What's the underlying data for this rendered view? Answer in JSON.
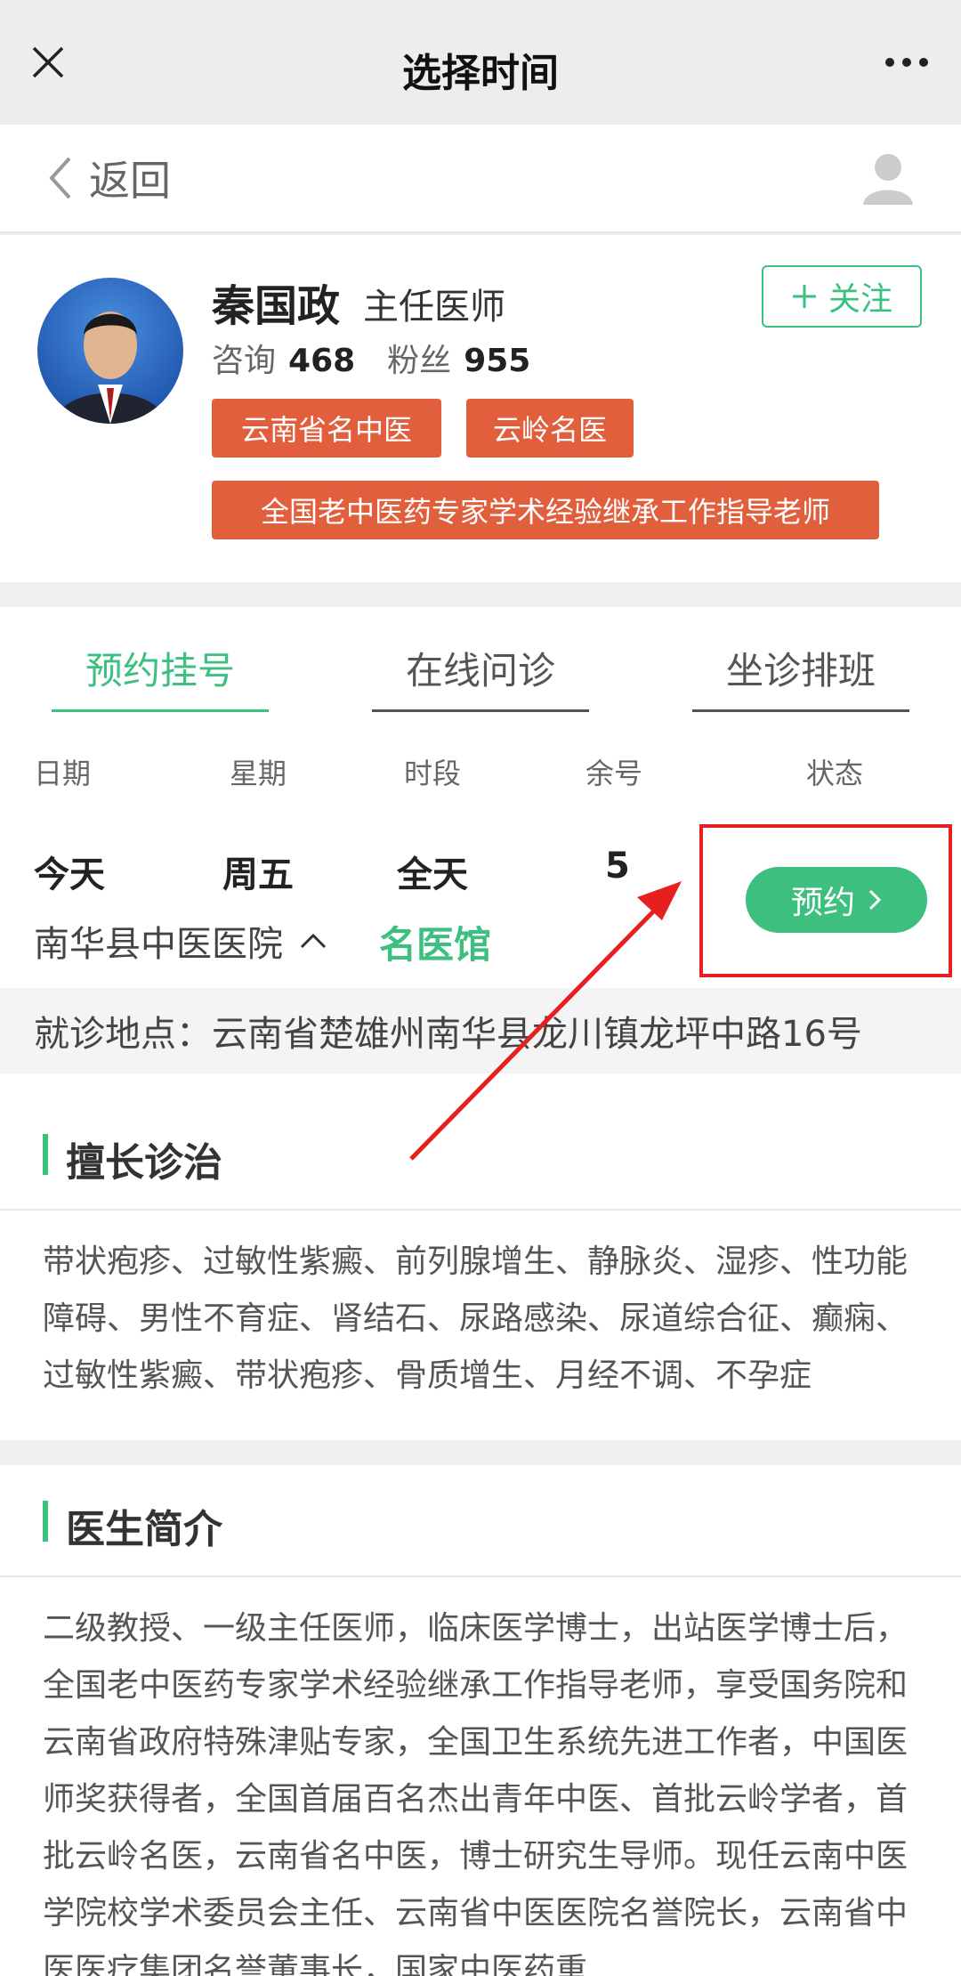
{
  "topbar": {
    "title": "选择时间"
  },
  "backbar": {
    "back_label": "返回"
  },
  "doctor": {
    "name": "秦国政",
    "title": "主任医师",
    "follow_label": "关注",
    "consult_label": "咨询",
    "consult_count": "468",
    "fans_label": "粉丝",
    "fans_count": "955",
    "tags": [
      "云南省名中医",
      "云岭名医",
      "全国老中医药专家学术经验继承工作指导老师"
    ]
  },
  "tabs": [
    {
      "label": "预约挂号",
      "active": true
    },
    {
      "label": "在线问诊",
      "active": false
    },
    {
      "label": "坐诊排班",
      "active": false
    }
  ],
  "schedule": {
    "headers": [
      "日期",
      "星期",
      "时段",
      "余号",
      "状态"
    ],
    "row": {
      "date": "今天",
      "weekday": "周五",
      "period": "全天",
      "remaining": "5",
      "hospital": "南华县中医医院",
      "clinic": "名医馆",
      "book_label": "预约"
    },
    "location": "就诊地点：云南省楚雄州南华县龙川镇龙坪中路16号"
  },
  "skills": {
    "title": "擅长诊治",
    "text": "带状疱疹、过敏性紫癜、前列腺增生、静脉炎、湿疹、性功能障碍、男性不育症、肾结石、尿路感染、尿道综合征、癫痫、过敏性紫癜、带状疱疹、骨质增生、月经不调、不孕症"
  },
  "intro": {
    "title": "医生简介",
    "text": "二级教授、一级主任医师，临床医学博士，出站医学博士后，全国老中医药专家学术经验继承工作指导老师，享受国务院和云南省政府特殊津贴专家，全国卫生系统先进工作者，中国医师奖获得者，全国首届百名杰出青年中医、首批云岭学者，首批云岭名医，云南省名中医，博士研究生导师。现任云南中医学院校学术委员会主任、云南省中医医院名誉院长，云南省中医医疗集团名誉董事长，国家中医药重"
  },
  "colors": {
    "accent": "#3cbf7f",
    "tag": "#e15f3c",
    "annotation": "#e61f1f"
  }
}
